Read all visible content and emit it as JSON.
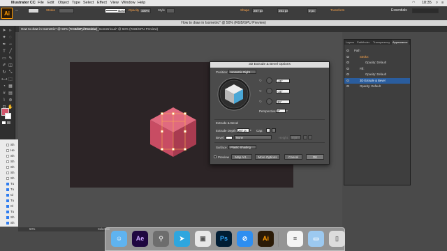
{
  "menubar": {
    "app": "Illustrator CC",
    "items": [
      "File",
      "Edit",
      "Object",
      "Type",
      "Select",
      "Effect",
      "View",
      "Window",
      "Help"
    ],
    "workspace": "Essentials",
    "clock": "18:35"
  },
  "control": {
    "logo": "Ai",
    "stroke_label": "Stroke",
    "stroke_style": "Basic",
    "opacity_label": "Opacity",
    "opacity_value": "100%",
    "style_label": "Style",
    "shape_label": "Shape",
    "width_value": "287 px",
    "height_value": "261 px",
    "corner_value": "0 px",
    "transform_label": "Transform"
  },
  "doc": {
    "title": "How to draw in Isometric* @ 50% (RGB/GPU Preview)",
    "tabs": [
      "How to draw in Isometric* @ 50% (RGB/GPU Preview)",
      "Solar_illustration_IsometricLai* @ 50% (RGB/GPU Preview)"
    ]
  },
  "layers": [
    {
      "label": "Sh",
      "checked": false
    },
    {
      "label": "He",
      "checked": false
    },
    {
      "label": "Sh",
      "checked": false
    },
    {
      "label": "Sh",
      "checked": false
    },
    {
      "label": "Sh",
      "checked": false
    },
    {
      "label": "Sh",
      "checked": false
    },
    {
      "label": "Sh",
      "checked": false
    },
    {
      "label": "Tu",
      "checked": true
    },
    {
      "label": "Tu",
      "checked": true
    },
    {
      "label": "Cl",
      "checked": true
    },
    {
      "label": "Tu",
      "checked": true
    },
    {
      "label": "Cl",
      "checked": true
    },
    {
      "label": "Tu",
      "checked": true
    },
    {
      "label": "Sh",
      "checked": true
    },
    {
      "label": "Sh",
      "checked": true
    }
  ],
  "dialog": {
    "title": "3D Extrude & Bevel Options",
    "position_label": "Position:",
    "position_value": "Isometric Right",
    "rot_x": "-45°",
    "rot_y": "-35°",
    "rot_z": "30°",
    "perspective_label": "Perspective:",
    "perspective_value": "0°",
    "section_label": "Extrude & Bevel",
    "depth_label": "Extrude Depth:",
    "depth_value": "287 pt",
    "cap_label": "Cap:",
    "bevel_label": "Bevel:",
    "bevel_value": "None",
    "height_label": "Height:",
    "height_value": "4 pt",
    "surface_label": "Surface:",
    "surface_value": "Plastic Shading",
    "preview_label": "Preview",
    "map_art": "Map Art...",
    "more_options": "More Options",
    "cancel": "Cancel",
    "ok": "OK"
  },
  "appearance": {
    "tabs": [
      "Layers",
      "Pathfinder",
      "Transparency",
      "Appearance"
    ],
    "rows": [
      {
        "label": "Path",
        "indent": 0,
        "selected": false
      },
      {
        "label": "Stroke:",
        "indent": 1,
        "selected": false,
        "accent": true
      },
      {
        "label": "Opacity: Default",
        "indent": 2,
        "selected": false
      },
      {
        "label": "Fill:",
        "indent": 1,
        "selected": false
      },
      {
        "label": "Opacity: Default",
        "indent": 2,
        "selected": false
      },
      {
        "label": "3D Extrude & Bevel",
        "indent": 1,
        "selected": true
      },
      {
        "label": "Opacity: Default",
        "indent": 1,
        "selected": false
      }
    ]
  },
  "status": {
    "zoom": "50%",
    "tool": "Selection"
  },
  "dock": [
    {
      "name": "finder-icon",
      "label": ""
    },
    {
      "name": "after-effects-icon",
      "label": "Ae"
    },
    {
      "name": "launchpad-icon",
      "label": ""
    },
    {
      "name": "telegram-icon",
      "label": ""
    },
    {
      "name": "preview-icon",
      "label": ""
    },
    {
      "name": "photoshop-icon",
      "label": "Ps"
    },
    {
      "name": "safari-icon",
      "label": ""
    },
    {
      "name": "illustrator-icon",
      "label": "Ai"
    },
    {
      "name": "document-icon",
      "label": ""
    },
    {
      "name": "folder-icon",
      "label": ""
    },
    {
      "name": "trash-icon",
      "label": ""
    }
  ],
  "colors": {
    "cube_top": "#e06a7f",
    "cube_left": "#c84c63",
    "cube_right": "#a93b50",
    "artboard": "#2c2426",
    "selection": "#ffb44a",
    "ai_orange": "#ff9a00"
  }
}
